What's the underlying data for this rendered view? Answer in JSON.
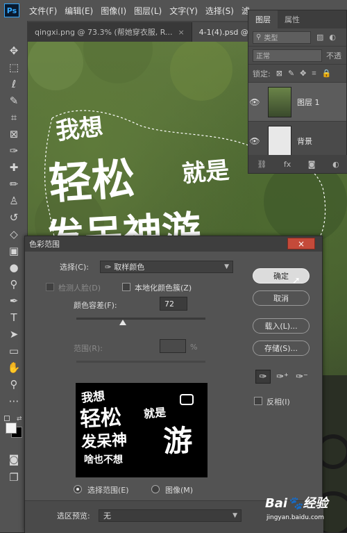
{
  "app": {
    "logo": "Ps"
  },
  "menu": [
    "文件(F)",
    "编辑(E)",
    "图像(I)",
    "图层(L)",
    "文字(Y)",
    "选择(S)",
    "滤"
  ],
  "tabs": [
    {
      "label": "qingxi.png @ 73.3% (帮她穿衣服, R...",
      "close": "×"
    },
    {
      "label": "4-1(4).psd @ 74",
      "close": "×"
    }
  ],
  "canvas_text": {
    "line1": "我想",
    "line2a": "轻松",
    "line2b": "就是",
    "line3": "发呆神游"
  },
  "layers_panel": {
    "tabs": [
      "图层",
      "属性"
    ],
    "filter_placeholder": "类型",
    "blend_mode": "正常",
    "opacity_label": "不透",
    "lock_label": "锁定:",
    "layers": [
      {
        "name": "图层 1",
        "visible": true,
        "selected": true
      },
      {
        "name": "背景",
        "visible": true,
        "selected": false
      }
    ]
  },
  "dialog": {
    "title": "色彩范围",
    "close": "×",
    "select_label": "选择(C):",
    "select_value": "取样颜色",
    "detect_faces": "检测人脸(D)",
    "localized_clusters": "本地化颜色簇(Z)",
    "fuzziness_label": "颜色容差(F):",
    "fuzziness_value": "72",
    "fuzziness_fraction": 0.36,
    "range_label": "范围(R):",
    "range_unit": "%",
    "preview_text": {
      "line1": "我想",
      "line2a": "轻松",
      "line2b": "就是",
      "line3a": "发呆神",
      "line3b": "游",
      "line4": "啥也不想"
    },
    "radio_selection": "选择范围(E)",
    "radio_image": "图像(M)",
    "ok": "确定",
    "cancel": "取消",
    "load": "载入(L)...",
    "save": "存储(S)...",
    "invert": "反相(I)",
    "preview_label": "选区预览:",
    "preview_value": "无"
  },
  "watermark": {
    "logo": "Bai🐾经验",
    "url": "jingyan.baidu.com"
  }
}
